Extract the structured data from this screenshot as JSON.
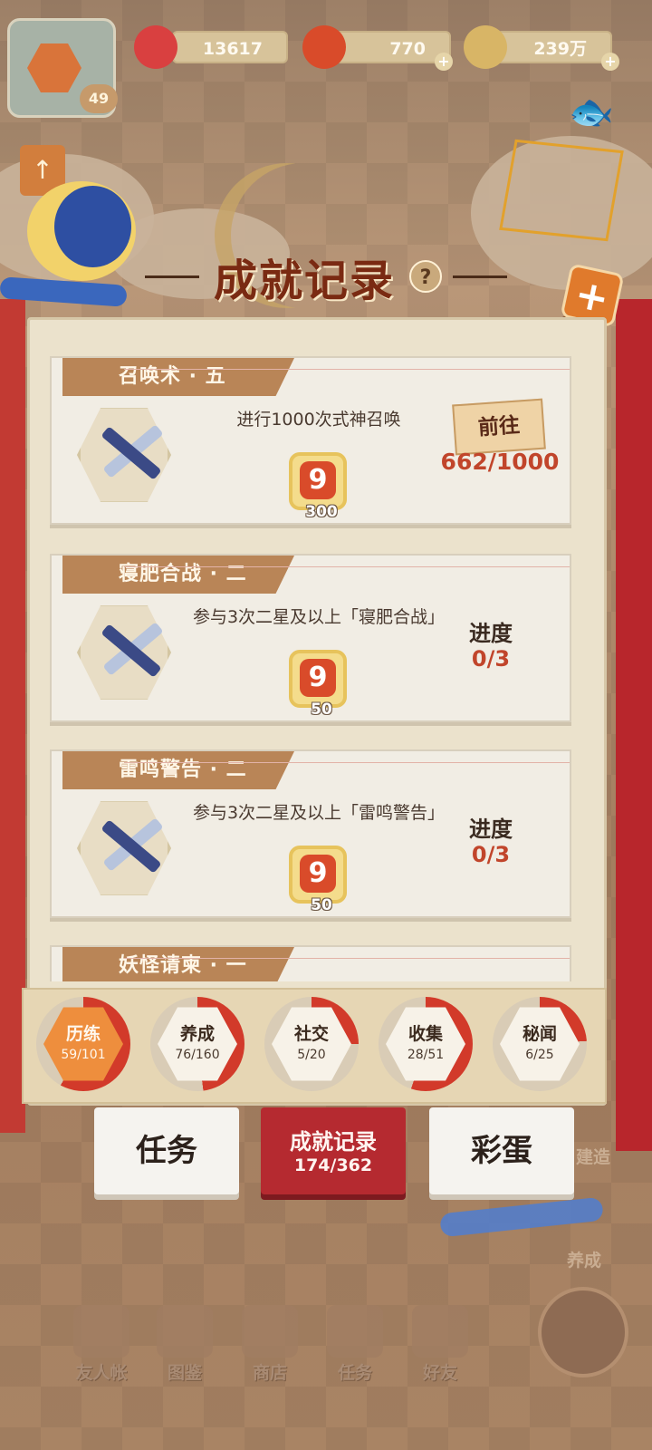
{
  "header": {
    "level": "49",
    "resources": [
      {
        "name": "stamina",
        "value": "13617",
        "color": "#d94040"
      },
      {
        "name": "gouyu",
        "value": "770",
        "color": "#d94b2a"
      },
      {
        "name": "coins",
        "value": "239万",
        "color": "#d8b566"
      }
    ]
  },
  "title": "成就记录",
  "achievements": [
    {
      "name": "召唤术 · 五",
      "desc": "进行1000次式神召唤",
      "reward": "300",
      "action": "前往",
      "progress": "662/1000"
    },
    {
      "name": "寝肥合战 · 二",
      "desc": "参与3次二星及以上「寝肥合战」",
      "reward": "50",
      "progress_label": "进度",
      "progress": "0/3"
    },
    {
      "name": "雷鸣警告 · 二",
      "desc": "参与3次二星及以上「雷鸣警告」",
      "reward": "50",
      "progress_label": "进度",
      "progress": "0/3"
    },
    {
      "name": "妖怪请柬 · 一"
    }
  ],
  "categories": [
    {
      "name": "历练",
      "count": "59/101",
      "ratio": 0.58,
      "active": true
    },
    {
      "name": "养成",
      "count": "76/160",
      "ratio": 0.48
    },
    {
      "name": "社交",
      "count": "5/20",
      "ratio": 0.25
    },
    {
      "name": "收集",
      "count": "28/51",
      "ratio": 0.55
    },
    {
      "name": "秘闻",
      "count": "6/25",
      "ratio": 0.24
    }
  ],
  "tabs": {
    "task": "任务",
    "record_title": "成就记录",
    "record_count": "174/362",
    "egg": "彩蛋"
  },
  "side": {
    "build": "建造",
    "raise": "养成"
  },
  "nav": [
    "友人帐",
    "图鉴",
    "商店",
    "任务",
    "好友"
  ],
  "icons": {
    "help": "?",
    "close": "+",
    "reward": "9",
    "plus": "+",
    "up": "↑"
  }
}
